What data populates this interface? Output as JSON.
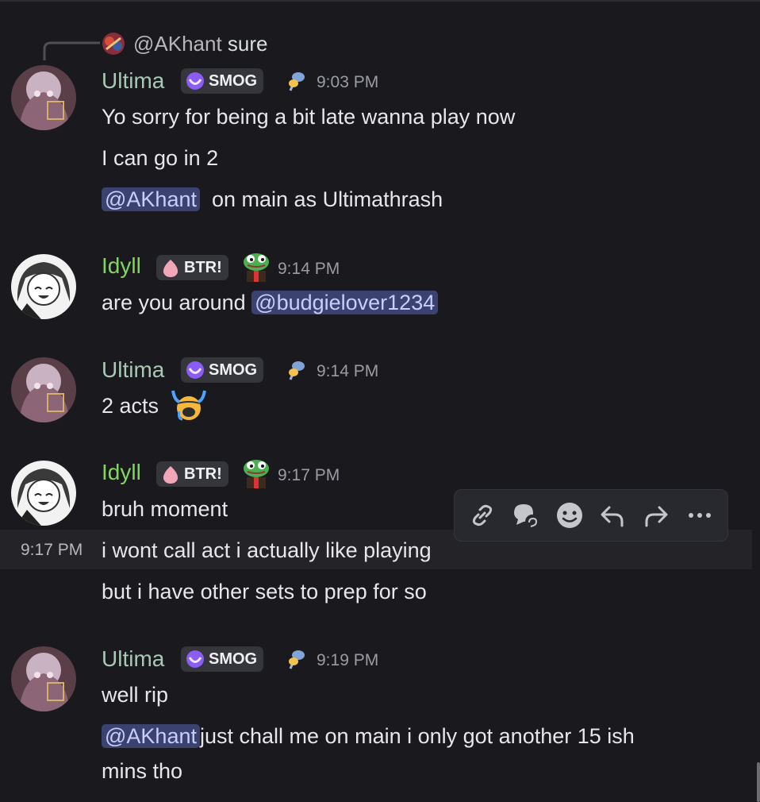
{
  "reply": {
    "mention": "@AKhant",
    "text": "sure"
  },
  "messages": [
    {
      "author": "Ultima",
      "tag": "SMOG",
      "time": "9:03 PM",
      "lines": [
        "Yo sorry for being a bit late wanna play now",
        "I can go in 2",
        "on main as Ultimathrash"
      ],
      "mention": "@AKhant"
    },
    {
      "author": "Idyll",
      "tag": "BTR!",
      "time": "9:14 PM",
      "text": "are you around",
      "mention": "@budgielover1234"
    },
    {
      "author": "Ultima",
      "tag": "SMOG",
      "time": "9:14 PM",
      "text": "2 acts"
    },
    {
      "author": "Idyll",
      "tag": "BTR!",
      "time": "9:17 PM",
      "lines": [
        "bruh moment",
        "i wont call act i actually like playing",
        "but i have other sets to prep for so"
      ],
      "hover_time": "9:17 PM"
    },
    {
      "author": "Ultima",
      "tag": "SMOG",
      "time": "9:19 PM",
      "lines": [
        "well rip",
        "just chall me on main i only got another 15 ish",
        "mins tho"
      ],
      "mention": "@AKhant"
    }
  ],
  "toolbar": [
    "link-icon",
    "thread-icon",
    "reaction-icon",
    "reply-icon",
    "forward-icon",
    "more-icon"
  ],
  "colors": {
    "ultima": "#a9c8b6",
    "idyll": "#7fd85b",
    "mention_bg": "#3c4270",
    "background": "#1a1a1e"
  }
}
